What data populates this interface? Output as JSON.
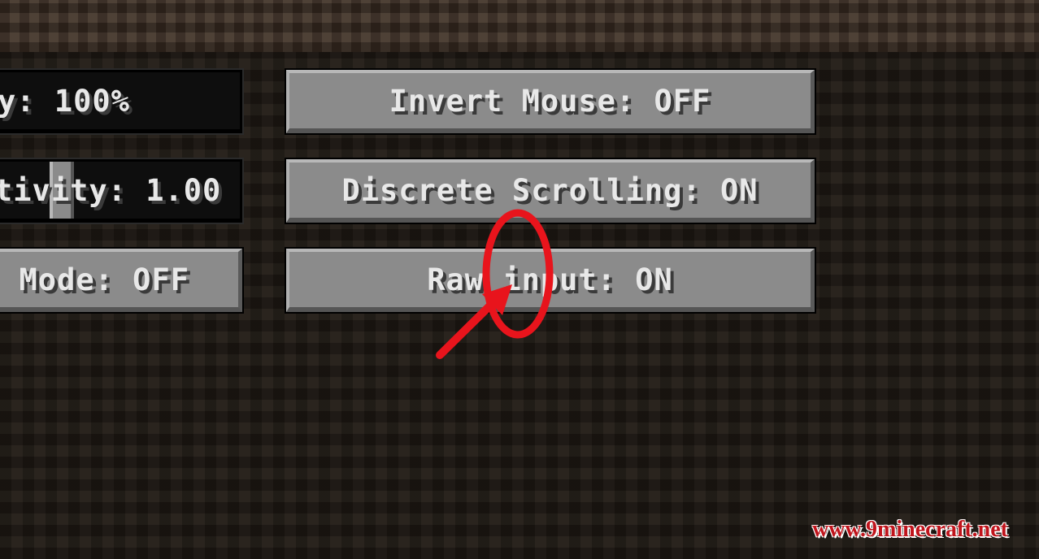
{
  "left_column": {
    "fov_label": "y: 100%",
    "sensitivity_label": "tivity: 1.00",
    "touchscreen_label": "Mode: OFF",
    "sensitivity_level": 0.5
  },
  "right_column": {
    "invert_mouse_label": "Invert Mouse: OFF",
    "discrete_scrolling_label": "Discrete Scrolling: ON",
    "raw_input_label": "Raw input: ON"
  },
  "annotation": {
    "color": "#e8141c"
  },
  "watermark": "www.9minecraft.net",
  "colors": {
    "button_face": "#8b8b8b",
    "slider_track": "#0e0e0e",
    "text": "#e8e8e8",
    "background": "#211b15"
  }
}
